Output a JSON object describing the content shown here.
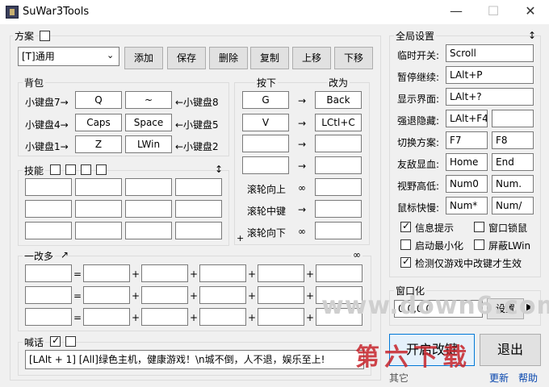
{
  "window": {
    "title": "SuWar3Tools",
    "min": "—",
    "max": "☐",
    "close": "✕"
  },
  "scheme": {
    "label": "方案",
    "selected": "[T]通用",
    "buttons": [
      "添加",
      "保存",
      "删除",
      "复制",
      "上移",
      "下移"
    ]
  },
  "bag": {
    "label": "背包",
    "rows": [
      {
        "left": "小键盘7→",
        "k1": "Q",
        "k2": "~",
        "right": "←小键盘8"
      },
      {
        "left": "小键盘4→",
        "k1": "Caps",
        "k2": "Space",
        "right": "←小键盘5"
      },
      {
        "left": "小键盘1→",
        "k1": "Z",
        "k2": "LWin",
        "right": "←小键盘2"
      }
    ]
  },
  "mapping": {
    "press_label": "按下",
    "to_label": "改为",
    "arrow": "→",
    "rows": [
      {
        "from": "G",
        "to": "Back"
      },
      {
        "from": "V",
        "to": "LCtl+C"
      },
      {
        "from": "",
        "to": ""
      },
      {
        "from": "",
        "to": ""
      }
    ],
    "wheel": [
      {
        "label": "滚轮向上",
        "sym": "∞"
      },
      {
        "label": "滚轮中键",
        "sym": "→"
      },
      {
        "label": "滚轮向下",
        "sym": "∞"
      }
    ],
    "plus": "+"
  },
  "skills": {
    "label": "技能",
    "sort_icon": "↕"
  },
  "multi": {
    "label": "一改多",
    "arrow": "↗",
    "inf": "∞",
    "eq": "=",
    "plus": "+"
  },
  "shout": {
    "label": "喊话",
    "text": "[LAlt + 1] [All]绿色主机，健康游戏！\\n城不倒，人不退，娱乐至上!"
  },
  "global": {
    "label": "全局设置",
    "sort_icon": "↕",
    "rows": [
      {
        "label": "临时开关:",
        "v1": "Scroll"
      },
      {
        "label": "暂停继续:",
        "v1": "LAlt+P"
      },
      {
        "label": "显示界面:",
        "v1": "LAlt+?"
      },
      {
        "label": "强退隐藏:",
        "v1": "LAlt+F4",
        "v2": ""
      },
      {
        "label": "切换方案:",
        "v1": "F7",
        "v2": "F8"
      },
      {
        "label": "友敌显血:",
        "v1": "Home",
        "v2": "End"
      },
      {
        "label": "视野高低:",
        "v1": "Num0",
        "v2": "Num."
      },
      {
        "label": "鼠标快慢:",
        "v1": "Num*",
        "v2": "Num/"
      }
    ],
    "checks": [
      {
        "label": "信息提示",
        "on": true
      },
      {
        "label": "窗口锁鼠",
        "on": false
      },
      {
        "label": "启动最小化",
        "on": false
      },
      {
        "label": "屏蔽LWin",
        "on": false
      },
      {
        "label": "检测仅游戏中改键才生效",
        "on": true
      }
    ]
  },
  "window_group": {
    "label": "窗口化",
    "coords": "0,0,0,0",
    "set": "设置"
  },
  "actions": {
    "start": "开启改键",
    "exit": "退出",
    "other": "其它",
    "update": "更新",
    "help": "帮助"
  },
  "watermark": {
    "site": "www.down6.com",
    "cn": "第六下载"
  }
}
